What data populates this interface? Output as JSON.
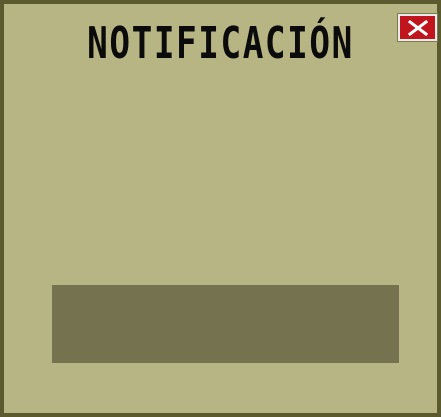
{
  "dialog": {
    "title": "NOTIFICACIÓN",
    "close_icon": "close-x-icon",
    "message": ""
  },
  "colors": {
    "background": "#b8b584",
    "border": "#5a5a2e",
    "close_button": "#c0151d",
    "message_box": "#75734f",
    "title_text": "#0b0b0b"
  }
}
